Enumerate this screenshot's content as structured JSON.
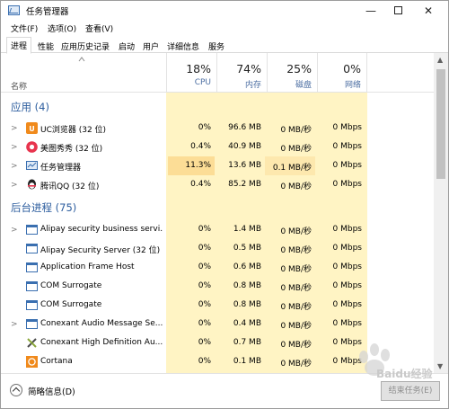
{
  "window": {
    "title": "任务管理器",
    "controls": [
      "—",
      "✕"
    ]
  },
  "menu": [
    "文件(F)",
    "选项(O)",
    "查看(V)"
  ],
  "tabs": [
    "进程",
    "性能",
    "应用历史记录",
    "启动",
    "用户",
    "详细信息",
    "服务"
  ],
  "active_tab": 0,
  "columns": {
    "name": "名称",
    "cpu": {
      "percent": "18%",
      "label": "CPU"
    },
    "memory": {
      "percent": "74%",
      "label": "内存"
    },
    "disk": {
      "percent": "25%",
      "label": "磁盘"
    },
    "network": {
      "percent": "0%",
      "label": "网络"
    }
  },
  "groups": {
    "apps": "应用 (4)",
    "background": "后台进程 (75)"
  },
  "apps": [
    {
      "name": "UC浏览器 (32 位)",
      "cpu": "0%",
      "mem": "96.6 MB",
      "disk": "0 MB/秒",
      "net": "0 Mbps",
      "icon": "uc-browser-icon"
    },
    {
      "name": "美图秀秀 (32 位)",
      "cpu": "0.4%",
      "mem": "40.9 MB",
      "disk": "0 MB/秒",
      "net": "0 Mbps",
      "icon": "meitu-icon"
    },
    {
      "name": "任务管理器",
      "cpu": "11.3%",
      "mem": "13.6 MB",
      "disk": "0.1 MB/秒",
      "net": "0 Mbps",
      "icon": "task-manager-icon"
    },
    {
      "name": "腾讯QQ (32 位)",
      "cpu": "0.4%",
      "mem": "85.2 MB",
      "disk": "0 MB/秒",
      "net": "0 Mbps",
      "icon": "qq-icon"
    }
  ],
  "background": [
    {
      "name": "Alipay security business servi...",
      "cpu": "0%",
      "mem": "1.4 MB",
      "disk": "0 MB/秒",
      "net": "0 Mbps",
      "icon": "app-window-icon",
      "expand": true
    },
    {
      "name": "Alipay Security Server (32 位)",
      "cpu": "0%",
      "mem": "0.5 MB",
      "disk": "0 MB/秒",
      "net": "0 Mbps",
      "icon": "app-window-icon",
      "expand": false
    },
    {
      "name": "Application Frame Host",
      "cpu": "0%",
      "mem": "0.6 MB",
      "disk": "0 MB/秒",
      "net": "0 Mbps",
      "icon": "app-window-icon",
      "expand": false
    },
    {
      "name": "COM Surrogate",
      "cpu": "0%",
      "mem": "0.8 MB",
      "disk": "0 MB/秒",
      "net": "0 Mbps",
      "icon": "app-window-icon",
      "expand": false
    },
    {
      "name": "COM Surrogate",
      "cpu": "0%",
      "mem": "0.8 MB",
      "disk": "0 MB/秒",
      "net": "0 Mbps",
      "icon": "app-window-icon",
      "expand": false
    },
    {
      "name": "Conexant Audio Message Se...",
      "cpu": "0%",
      "mem": "0.4 MB",
      "disk": "0 MB/秒",
      "net": "0 Mbps",
      "icon": "app-window-icon",
      "expand": true
    },
    {
      "name": "Conexant High Definition Au...",
      "cpu": "0%",
      "mem": "0.7 MB",
      "disk": "0 MB/秒",
      "net": "0 Mbps",
      "icon": "tools-icon",
      "expand": false
    },
    {
      "name": "Cortana",
      "cpu": "0%",
      "mem": "0.1 MB",
      "disk": "0 MB/秒",
      "net": "0 Mbps",
      "icon": "cortana-icon",
      "expand": false
    }
  ],
  "footer": {
    "fewer_details": "简略信息(D)",
    "end_task": "结束任务(E)"
  },
  "watermark": "Baidu经验",
  "colors": {
    "accent_blue": "#2c5d9e",
    "cpu_column": "#fff4c4",
    "cpu_highlight": "#fcdd96"
  }
}
